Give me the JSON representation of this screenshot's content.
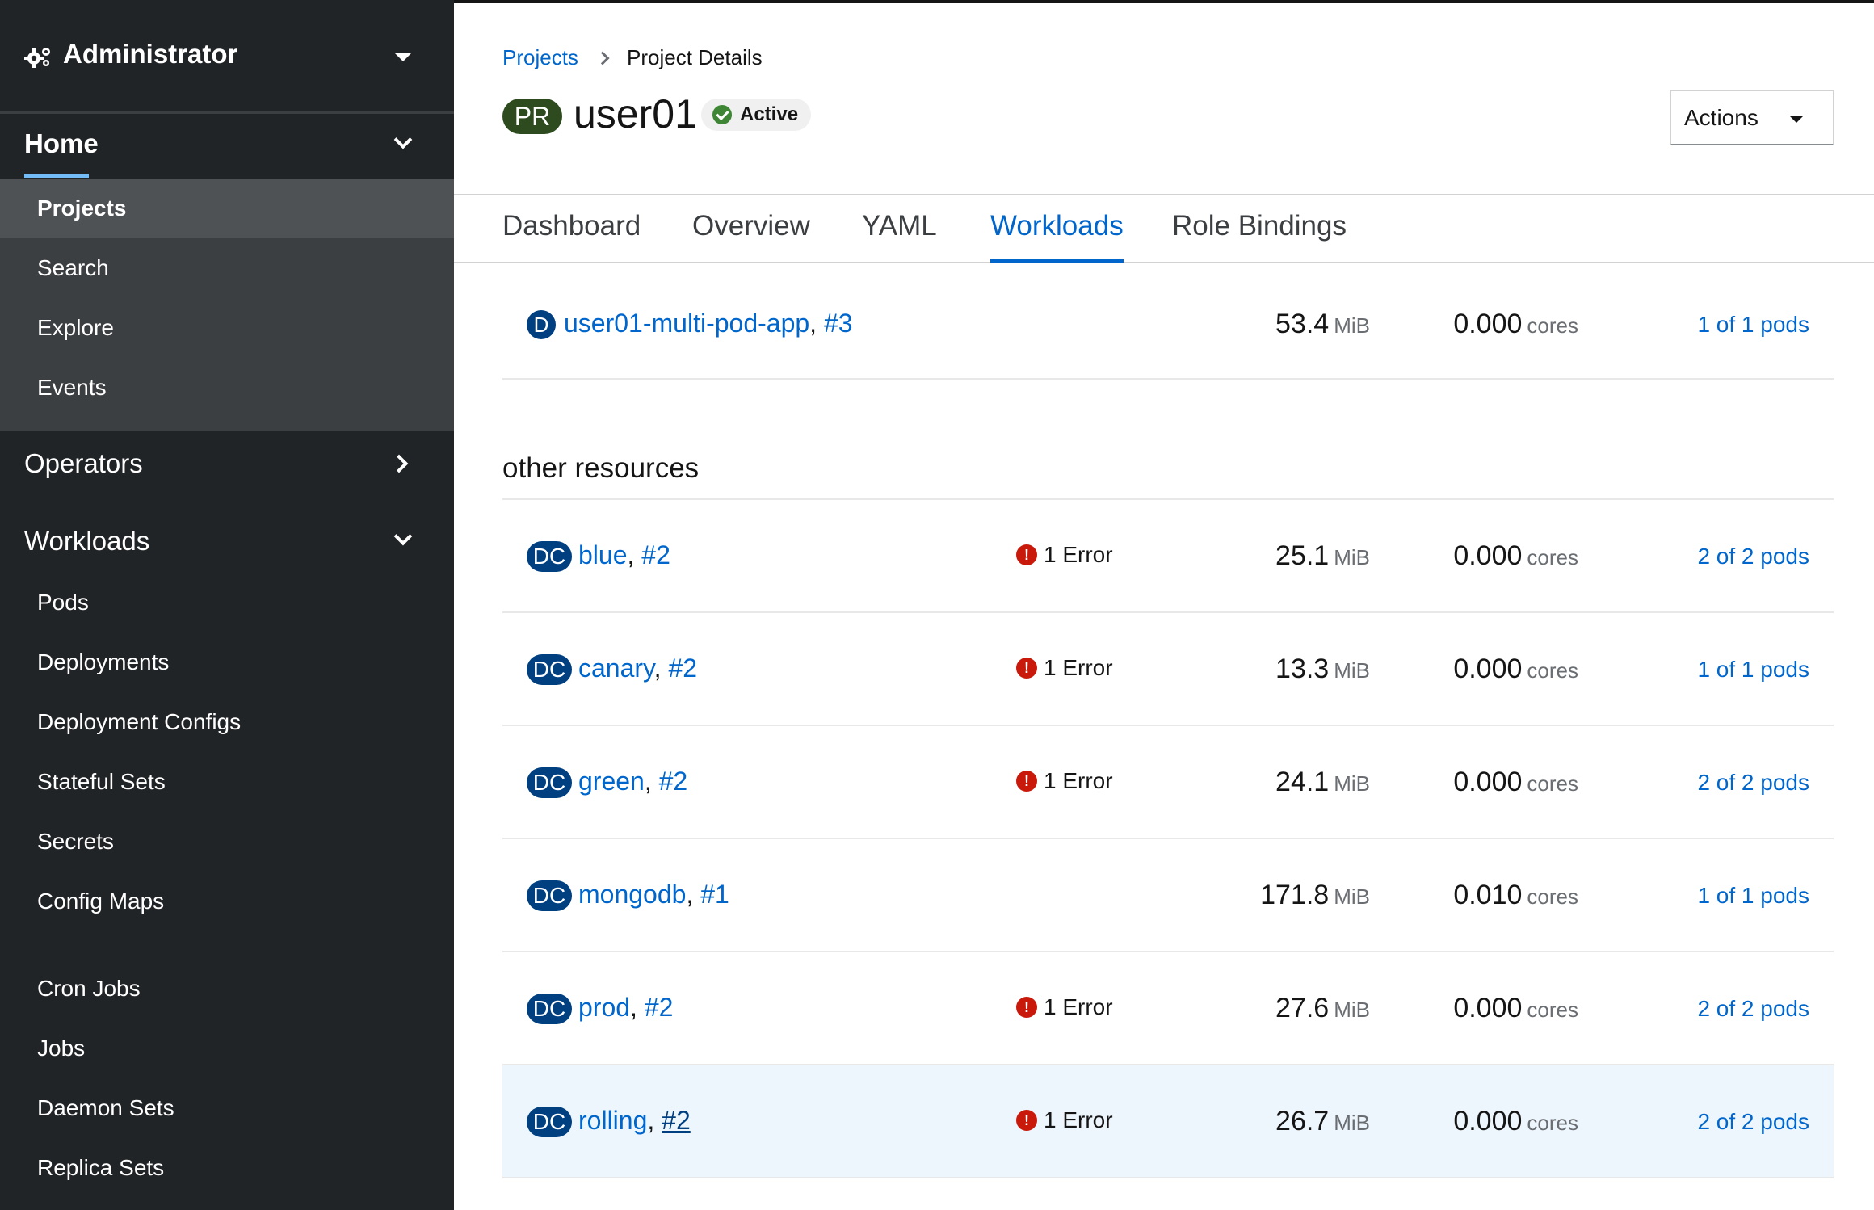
{
  "sidebar": {
    "perspective": "Administrator",
    "home": {
      "label": "Home",
      "items": [
        "Projects",
        "Search",
        "Explore",
        "Events"
      ]
    },
    "operators": "Operators",
    "workloads": {
      "label": "Workloads",
      "items": [
        "Pods",
        "Deployments",
        "Deployment Configs",
        "Stateful Sets",
        "Secrets",
        "Config Maps",
        "Cron Jobs",
        "Jobs",
        "Daemon Sets",
        "Replica Sets"
      ]
    }
  },
  "breadcrumb": {
    "link": "Projects",
    "current": "Project Details"
  },
  "project": {
    "badge": "PR",
    "name": "user01",
    "status": "Active"
  },
  "actions_label": "Actions",
  "tabs": [
    "Dashboard",
    "Overview",
    "YAML",
    "Workloads",
    "Role Bindings"
  ],
  "top_row": {
    "badge": "D",
    "name": "user01-multi-pod-app",
    "rev": "#3",
    "mem": "53.4",
    "mem_unit": "MiB",
    "cpu": "0.000",
    "cpu_unit": "cores",
    "pods": "1 of 1 pods"
  },
  "other_heading": "other resources",
  "rows": [
    {
      "badge": "DC",
      "name": "blue",
      "rev": "#2",
      "error": "1 Error",
      "mem": "25.1",
      "mem_unit": "MiB",
      "cpu": "0.000",
      "cpu_unit": "cores",
      "pods": "2 of 2 pods"
    },
    {
      "badge": "DC",
      "name": "canary",
      "rev": "#2",
      "error": "1 Error",
      "mem": "13.3",
      "mem_unit": "MiB",
      "cpu": "0.000",
      "cpu_unit": "cores",
      "pods": "1 of 1 pods"
    },
    {
      "badge": "DC",
      "name": "green",
      "rev": "#2",
      "error": "1 Error",
      "mem": "24.1",
      "mem_unit": "MiB",
      "cpu": "0.000",
      "cpu_unit": "cores",
      "pods": "2 of 2 pods"
    },
    {
      "badge": "DC",
      "name": "mongodb",
      "rev": "#1",
      "error": "",
      "mem": "171.8",
      "mem_unit": "MiB",
      "cpu": "0.010",
      "cpu_unit": "cores",
      "pods": "1 of 1 pods"
    },
    {
      "badge": "DC",
      "name": "prod",
      "rev": "#2",
      "error": "1 Error",
      "mem": "27.6",
      "mem_unit": "MiB",
      "cpu": "0.000",
      "cpu_unit": "cores",
      "pods": "2 of 2 pods"
    },
    {
      "badge": "DC",
      "name": "rolling",
      "rev": "#2",
      "error": "1 Error",
      "mem": "26.7",
      "mem_unit": "MiB",
      "cpu": "0.000",
      "cpu_unit": "cores",
      "pods": "2 of 2 pods"
    }
  ],
  "colors": {
    "link": "#0066cc",
    "badge": "#004080",
    "error": "#c9190b",
    "active": "#3e8635",
    "sidebar": "#212427"
  }
}
